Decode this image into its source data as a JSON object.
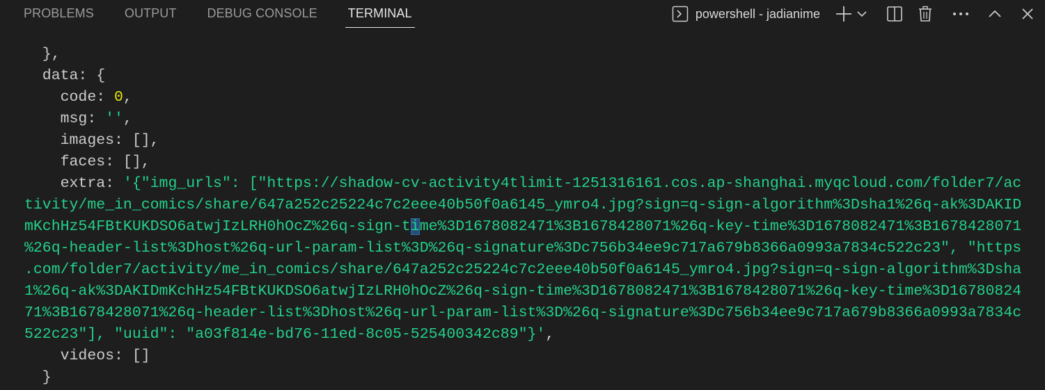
{
  "tabs": [
    {
      "label": "PROBLEMS"
    },
    {
      "label": "OUTPUT"
    },
    {
      "label": "DEBUG CONSOLE"
    },
    {
      "label": "TERMINAL"
    }
  ],
  "active_tab": "TERMINAL",
  "terminal": {
    "name": "powershell - jadianime"
  },
  "icons": {
    "terminal": "terminal-icon",
    "add": "plus-icon",
    "dropdown": "chevron-down-icon",
    "split": "split-icon",
    "kill": "trash-icon",
    "more": "ellipsis-icon",
    "maximize": "chevron-up-icon",
    "close": "close-icon"
  },
  "colors": {
    "background": "#1e1e1e",
    "text": "#cccccc",
    "string": "#23d18b",
    "number": "#e5e510",
    "cursor": "#264f78"
  },
  "output": {
    "l1": "  },",
    "l2": "  data: {",
    "l3a": "    code: ",
    "l3b": "0",
    "l3c": ",",
    "l4a": "    msg: ",
    "l4b": "''",
    "l4c": ",",
    "l5": "    images: [],",
    "l6": "    faces: [],",
    "l7a": "    extra: ",
    "l7b": "'{\"img_urls\": [\"https://shadow-cv-activity4tlimit-1251316161.cos.ap-shanghai.myqcloud.com/folder7/ac",
    "l8": "tivity/me_in_comics/share/647a252c25224c7c2eee40b50f0a6145_ymro4.jpg?sign=q-sign-algorithm%3Dsha1%26q-ak%3DAKID",
    "l9a": "mKchHz54FBtKUKDSO6atwjIzLRH0hOcZ%26q-sign-t",
    "l9b": "i",
    "l9c": "me%3D1678082471%3B1678428071%26q-key-time%3D1678082471%3B1678428071",
    "l10": "%26q-header-list%3Dhost%26q-url-param-list%3D%26q-signature%3Dc756b34ee9c717a679b8366a0993a7834c522c23\", \"https",
    "l11": ".com/folder7/activity/me_in_comics/share/647a252c25224c7c2eee40b50f0a6145_ymro4.jpg?sign=q-sign-algorithm%3Dsha",
    "l12": "1%26q-ak%3DAKIDmKchHz54FBtKUKDSO6atwjIzLRH0hOcZ%26q-sign-time%3D1678082471%3B1678428071%26q-key-time%3D16780824",
    "l13": "71%3B1678428071%26q-header-list%3Dhost%26q-url-param-list%3D%26q-signature%3Dc756b34ee9c717a679b8366a0993a7834c",
    "l14": "522c23\"], \"uuid\": \"a03f814e-bd76-11ed-8c05-525400342c89\"}'",
    "l14b": ",",
    "l15": "    videos: []",
    "l16": "  }"
  }
}
